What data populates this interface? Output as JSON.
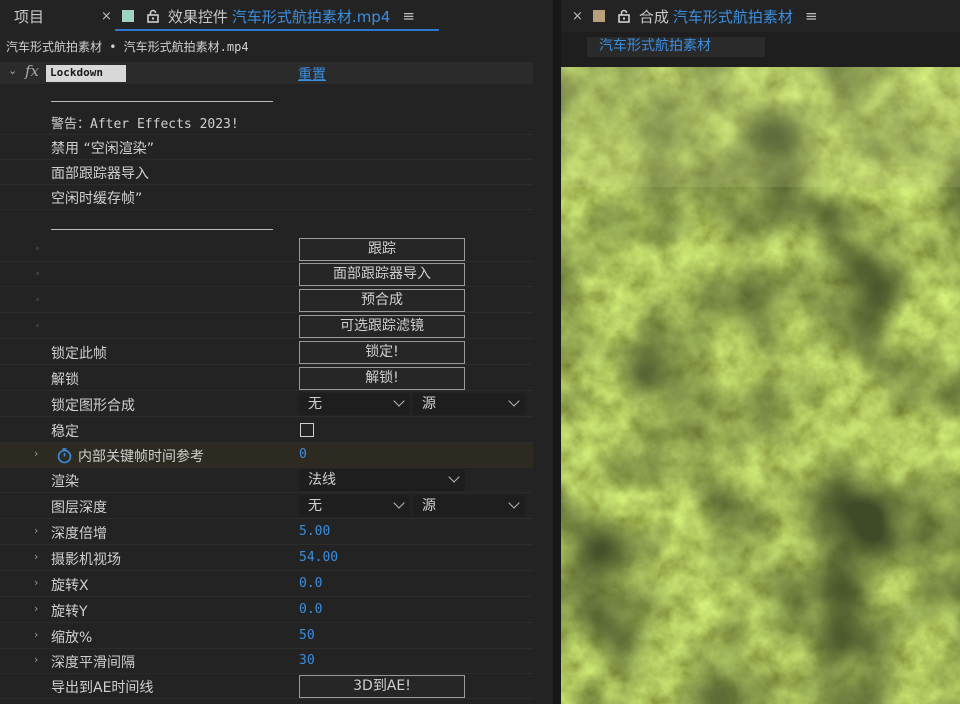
{
  "tabs": {
    "project": "项目",
    "effect_controls": {
      "prefix": "效果控件",
      "clip": "汽车形式航拍素材.mp4"
    },
    "composition": {
      "prefix": "合成",
      "name": "汽车形式航拍素材"
    },
    "close_glyph": "×",
    "menu_glyph": "≡"
  },
  "effect_panel": {
    "breadcrumb": "汽车形式航拍素材 • 汽车形式航拍素材.mp4",
    "effect_name": "Lockdown",
    "reset_label": "重置",
    "notes": [
      "警告：After Effects 2023!",
      "禁用 “空闲渲染”",
      "面部跟踪器导入",
      "空闲时缓存帧”"
    ],
    "buttons": {
      "track": "跟踪",
      "face_import": "面部跟踪器导入",
      "precomp": "预合成",
      "optional_filter": "可选跟踪滤镜",
      "lock": "锁定!",
      "unlock": "解锁!",
      "export_3d": "3D到AE!"
    },
    "rows": {
      "lock_frame": "锁定此帧",
      "unlock": "解锁",
      "lock_comp": "锁定图形合成",
      "stabilize": "稳定",
      "keyframe_ref": "内部关键帧时间参考",
      "keyframe_ref_value": "0",
      "render": "渲染",
      "layer_depth": "图层深度",
      "depth_multiplier": "深度倍增",
      "depth_multiplier_value": "5.00",
      "camera_fov": "摄影机视场",
      "camera_fov_value": "54.00",
      "rotate_x": "旋转X",
      "rotate_x_value": "0.0",
      "rotate_y": "旋转Y",
      "rotate_y_value": "0.0",
      "scale": "缩放%",
      "scale_value": "50",
      "depth_smooth": "深度平滑间隔",
      "depth_smooth_value": "30",
      "export_timeline": "导出到AE时间线"
    },
    "selects": {
      "lock_comp_layer": "无",
      "lock_comp_source": "源",
      "render_mode": "法线",
      "layer_depth_layer": "无",
      "layer_depth_source": "源"
    },
    "stabilize_checked": false
  },
  "colors": {
    "accent_blue": "#3b8ee0",
    "footage_swatch": "#9ed3c4",
    "comp_swatch": "#b8a07a"
  },
  "icons": {
    "expand": "chevron-down-icon",
    "collapsed": "chevron-right-icon",
    "stopwatch": "stopwatch-icon",
    "lock": "lock-icon"
  }
}
